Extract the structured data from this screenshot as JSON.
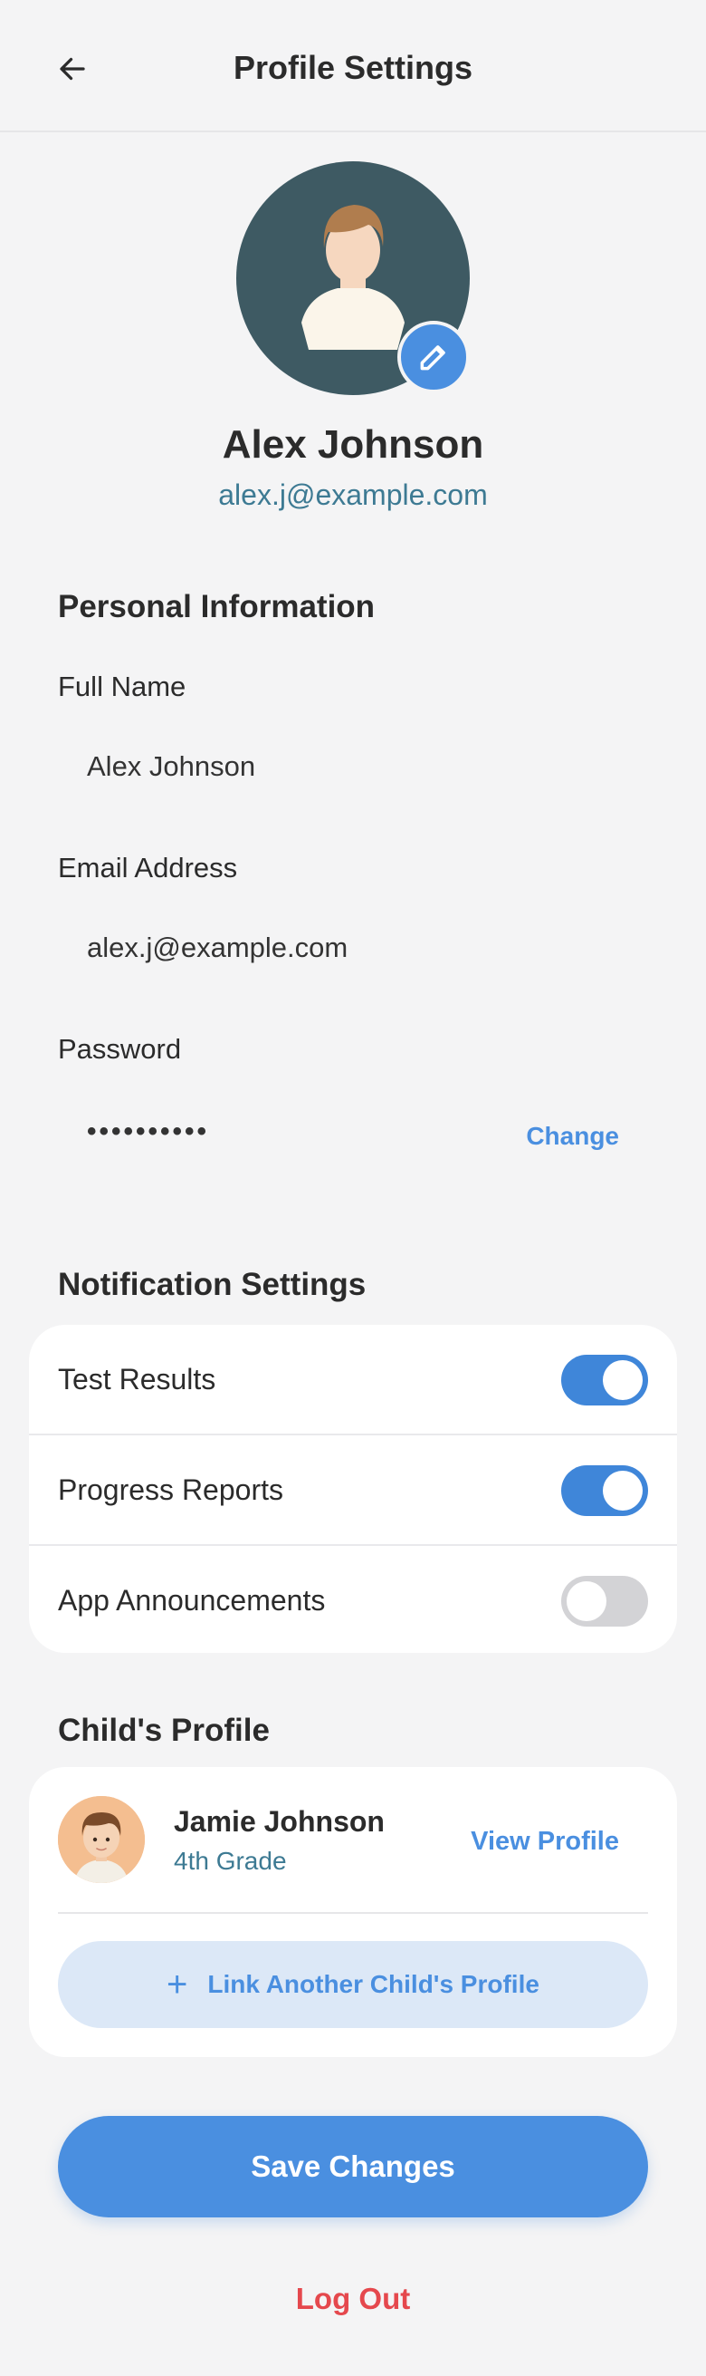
{
  "header": {
    "title": "Profile Settings",
    "back_icon": "arrow-left-icon"
  },
  "profile": {
    "name": "Alex Johnson",
    "email": "alex.j@example.com",
    "edit_icon": "pencil-icon"
  },
  "personal_info": {
    "title": "Personal Information",
    "full_name_label": "Full Name",
    "full_name_value": "Alex Johnson",
    "email_label": "Email Address",
    "email_value": "alex.j@example.com",
    "password_label": "Password",
    "password_value": "••••••••••",
    "change_label": "Change"
  },
  "notifications": {
    "title": "Notification Settings",
    "items": [
      {
        "label": "Test Results",
        "enabled": true
      },
      {
        "label": "Progress Reports",
        "enabled": true
      },
      {
        "label": "App Announcements",
        "enabled": false
      }
    ]
  },
  "child_profile": {
    "title": "Child's Profile",
    "name": "Jamie Johnson",
    "grade": "4th Grade",
    "view_label": "View Profile",
    "link_label": "Link Another Child's Profile"
  },
  "actions": {
    "save_label": "Save Changes",
    "logout_label": "Log Out"
  },
  "colors": {
    "accent": "#4a8fe0",
    "toggle_on": "#3f86d9",
    "toggle_off": "#d3d3d6",
    "logout": "#e5484d",
    "email_text": "#3d7a93"
  }
}
